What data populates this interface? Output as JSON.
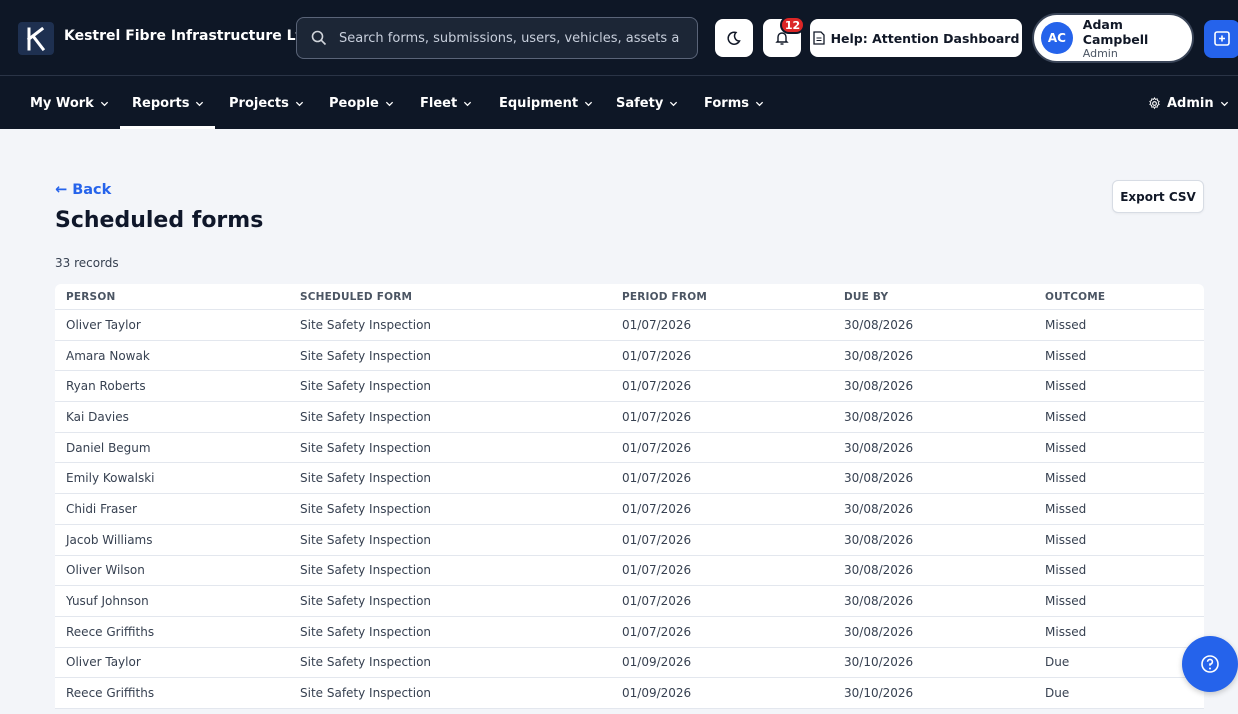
{
  "header": {
    "company_name": "Kestrel Fibre Infrastructure Ltd",
    "search_placeholder": "Search forms, submissions, users, vehicles, assets and more",
    "notification_count": "12",
    "help_label": "Help: Attention Dashboard",
    "user": {
      "initials": "AC",
      "name": "Adam Campbell",
      "role": "Admin"
    }
  },
  "nav": {
    "items": [
      {
        "label": "My Work"
      },
      {
        "label": "Reports"
      },
      {
        "label": "Projects"
      },
      {
        "label": "People"
      },
      {
        "label": "Fleet"
      },
      {
        "label": "Equipment"
      },
      {
        "label": "Safety"
      },
      {
        "label": "Forms"
      }
    ],
    "active": "Reports",
    "admin_label": "Admin"
  },
  "page": {
    "back_label": "← Back",
    "title": "Scheduled forms",
    "record_count": "33 records",
    "export_label": "Export CSV"
  },
  "table": {
    "columns": [
      "PERSON",
      "SCHEDULED FORM",
      "PERIOD FROM",
      "DUE BY",
      "OUTCOME"
    ],
    "rows": [
      [
        "Oliver Taylor",
        "Site Safety Inspection",
        "01/07/2026",
        "30/08/2026",
        "Missed"
      ],
      [
        "Amara Nowak",
        "Site Safety Inspection",
        "01/07/2026",
        "30/08/2026",
        "Missed"
      ],
      [
        "Ryan Roberts",
        "Site Safety Inspection",
        "01/07/2026",
        "30/08/2026",
        "Missed"
      ],
      [
        "Kai Davies",
        "Site Safety Inspection",
        "01/07/2026",
        "30/08/2026",
        "Missed"
      ],
      [
        "Daniel Begum",
        "Site Safety Inspection",
        "01/07/2026",
        "30/08/2026",
        "Missed"
      ],
      [
        "Emily Kowalski",
        "Site Safety Inspection",
        "01/07/2026",
        "30/08/2026",
        "Missed"
      ],
      [
        "Chidi Fraser",
        "Site Safety Inspection",
        "01/07/2026",
        "30/08/2026",
        "Missed"
      ],
      [
        "Jacob Williams",
        "Site Safety Inspection",
        "01/07/2026",
        "30/08/2026",
        "Missed"
      ],
      [
        "Oliver Wilson",
        "Site Safety Inspection",
        "01/07/2026",
        "30/08/2026",
        "Missed"
      ],
      [
        "Yusuf Johnson",
        "Site Safety Inspection",
        "01/07/2026",
        "30/08/2026",
        "Missed"
      ],
      [
        "Reece Griffiths",
        "Site Safety Inspection",
        "01/07/2026",
        "30/08/2026",
        "Missed"
      ],
      [
        "Oliver Taylor",
        "Site Safety Inspection",
        "01/09/2026",
        "30/10/2026",
        "Due"
      ],
      [
        "Reece Griffiths",
        "Site Safety Inspection",
        "01/09/2026",
        "30/10/2026",
        "Due"
      ]
    ]
  },
  "icons": {
    "logo": "kestrel-logo-icon",
    "search": "search-icon",
    "theme": "moon-icon",
    "notifications": "bell-icon",
    "help": "document-icon",
    "new": "plus-square-icon",
    "admin": "gear-icon",
    "support": "help-circle-icon"
  },
  "colors": {
    "header_bg": "#0e1726",
    "accent": "#2563eb",
    "badge": "#dc2626"
  }
}
